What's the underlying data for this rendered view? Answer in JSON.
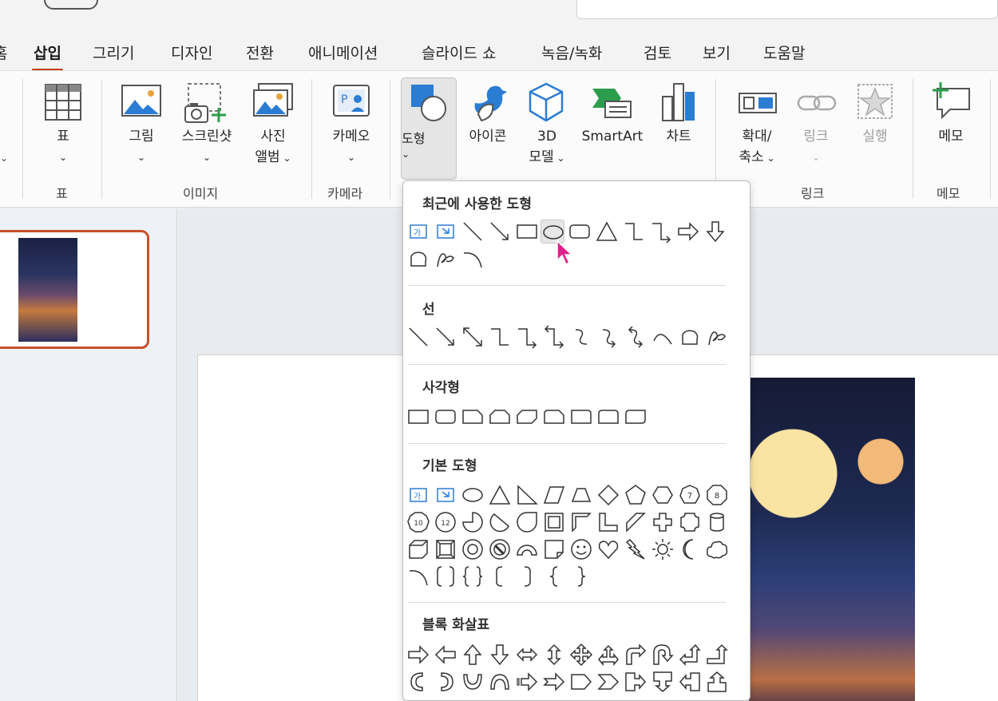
{
  "tabs": [
    {
      "label": "홈",
      "active": false
    },
    {
      "label": "삽입",
      "active": true
    },
    {
      "label": "그리기",
      "active": false
    },
    {
      "label": "디자인",
      "active": false
    },
    {
      "label": "전환",
      "active": false
    },
    {
      "label": "애니메이션",
      "active": false
    },
    {
      "label": "슬라이드 쇼",
      "active": false
    },
    {
      "label": "녹음/녹화",
      "active": false
    },
    {
      "label": "검토",
      "active": false
    },
    {
      "label": "보기",
      "active": false
    },
    {
      "label": "도움말",
      "active": false
    }
  ],
  "ribbon": {
    "table": {
      "label": "표",
      "group": "표"
    },
    "picture": {
      "label": "그림"
    },
    "screenshot": {
      "label": "스크린샷"
    },
    "album": {
      "label1": "사진",
      "label2": "앨범"
    },
    "images_group": "이미지",
    "cameo": {
      "label": "카메오"
    },
    "camera_group": "카메라",
    "shapes": {
      "label": "도형"
    },
    "icons": {
      "label": "아이콘"
    },
    "model3d": {
      "label1": "3D",
      "label2": "모델"
    },
    "smartart": {
      "label": "SmartArt"
    },
    "chart": {
      "label": "차트"
    },
    "zoom": {
      "label1": "확대/",
      "label2": "축소"
    },
    "link": {
      "label": "링크"
    },
    "action": {
      "label": "실행"
    },
    "links_group": "링크",
    "comment": {
      "label": "메모"
    },
    "comments_group": "메모"
  },
  "dropdown": {
    "sections": [
      {
        "title": "최근에 사용한 도형"
      },
      {
        "title": "선"
      },
      {
        "title": "사각형"
      },
      {
        "title": "기본 도형"
      },
      {
        "title": "블록 화살표"
      }
    ],
    "textbox_glyph": "가",
    "octagon_labels": [
      "7",
      "8",
      "10",
      "12"
    ]
  },
  "accent": "#c43e1c",
  "icon_blue": "#2b7cd3"
}
